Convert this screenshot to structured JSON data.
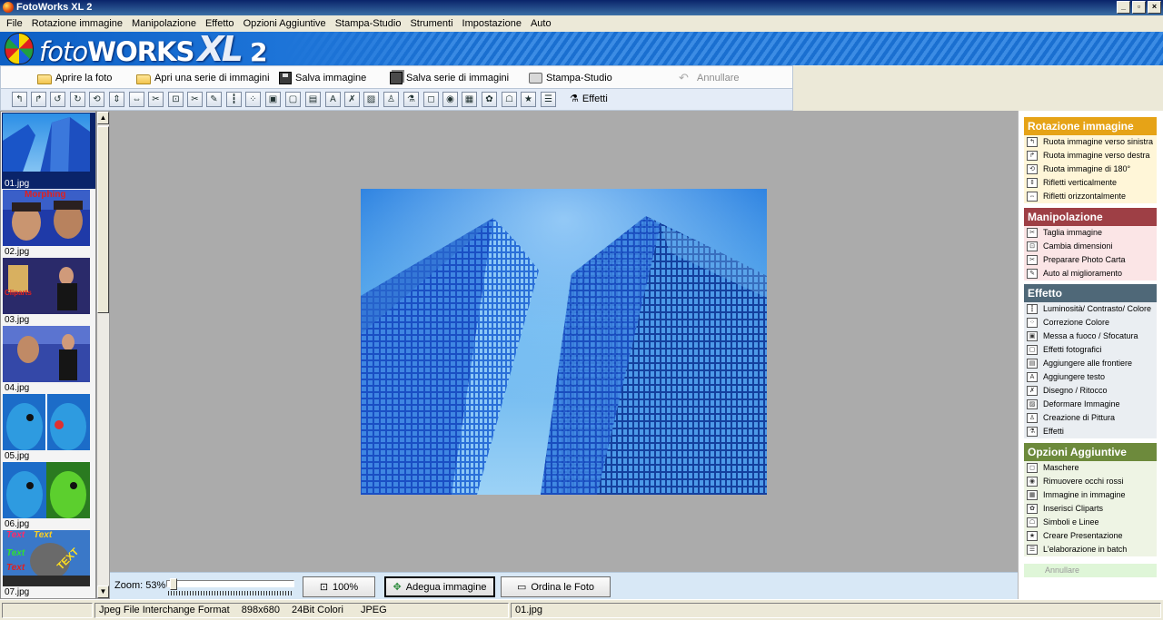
{
  "window": {
    "title": "FotoWorks XL 2"
  },
  "menu": [
    "File",
    "Rotazione immagine",
    "Manipolazione",
    "Effetto",
    "Opzioni Aggiuntive",
    "Stampa-Studio",
    "Strumenti",
    "Impostazione",
    "Auto"
  ],
  "banner": {
    "logo_foto": "foto",
    "logo_works": "WORKS",
    "logo_xl": "XL",
    "logo_num": "2"
  },
  "toolbar": {
    "open_photo": "Aprire la foto",
    "open_series": "Apri una serie di immagini",
    "save_image": "Salva immagine",
    "save_series": "Salva serie di immagini",
    "print_studio": "Stampa-Studio",
    "undo": "Annullare",
    "effects": "Effetti"
  },
  "thumbnails": [
    {
      "caption": "01.jpg",
      "selected": true
    },
    {
      "caption": "02.jpg",
      "overlay": "Morphing"
    },
    {
      "caption": "03.jpg",
      "overlay": "Cliparts"
    },
    {
      "caption": "04.jpg"
    },
    {
      "caption": "05.jpg"
    },
    {
      "caption": "06.jpg"
    },
    {
      "caption": "07.jpg",
      "overlay_lines": [
        "Text",
        "Text",
        "Text",
        "Text",
        "TEXT"
      ]
    }
  ],
  "bottom": {
    "zoom_label": "Zoom: 53%",
    "zoom_value": 53,
    "btn_100": "100%",
    "btn_fit": "Adegua immagine",
    "btn_sort": "Ordina le Foto"
  },
  "right_panel": {
    "rotation": {
      "header": "Rotazione immagine",
      "color": "#e6a317",
      "items": [
        "Ruota immagine verso sinistra",
        "Ruota immagine verso destra",
        "Ruota immagine di 180°",
        "Rifletti verticalmente",
        "Rifletti orizzontalmente"
      ]
    },
    "manipulation": {
      "header": "Manipolazione",
      "color": "#9e3f45",
      "items": [
        "Taglia immagine",
        "Cambia dimensioni",
        "Preparare Photo Carta",
        "Auto al miglioramento"
      ]
    },
    "effect": {
      "header": "Effetto",
      "color": "#4f6878",
      "items": [
        "Luminosità/ Contrasto/ Colore",
        "Correzione Colore",
        "Messa a fuoco / Sfocatura",
        "Effetti fotografici",
        "Aggiungere alle frontiere",
        "Aggiungere testo",
        "Disegno / Ritocco",
        "Deformare Immagine",
        "Creazione di Pittura",
        "Effetti"
      ]
    },
    "options": {
      "header": "Opzioni Aggiuntive",
      "color": "#6d8a3c",
      "items": [
        "Maschere",
        "Rimuovere occhi rossi",
        "Immagine in immagine",
        "Inserisci Cliparts",
        "Simboli e Linee",
        "Creare Presentazione",
        "L'elaborazione in batch"
      ]
    },
    "undo": "Annullare"
  },
  "status": {
    "format": "Jpeg File Interchange Format",
    "dimensions": "898x680",
    "colors": "24Bit Colori",
    "type": "JPEG",
    "filename": "01.jpg"
  }
}
